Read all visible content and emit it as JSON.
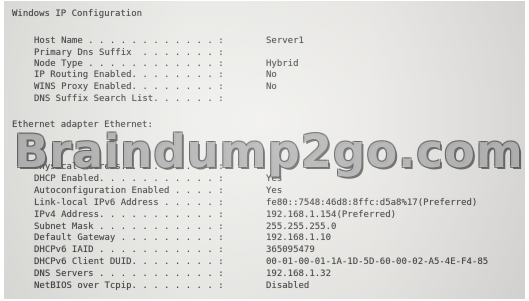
{
  "window_title": "Windows IP Configuration",
  "adapter_header": "Ethernet adapter Ethernet:",
  "watermark": "Braindump2go.com",
  "rows": [
    {
      "label": "Host Name . . . . . . . . . . . . :",
      "value": "Server1"
    },
    {
      "label": "Primary Dns Suffix  . . . . . . . :",
      "value": ""
    },
    {
      "label": "Node Type . . . . . . . . . . . . :",
      "value": "Hybrid"
    },
    {
      "label": "IP Routing Enabled. . . . . . . . :",
      "value": "No"
    },
    {
      "label": "WINS Proxy Enabled. . . . . . . . :",
      "value": "No"
    },
    {
      "label": "DNS Suffix Search List. . . . . . :",
      "value": ""
    },
    {
      "label": "Physical Address. . . . . . . . . :",
      "value": ""
    },
    {
      "label": "DHCP Enabled. . . . . . . . . . . :",
      "value": "Yes"
    },
    {
      "label": "Autoconfiguration Enabled . . . . :",
      "value": "Yes"
    },
    {
      "label": "Link-local IPv6 Address . . . . . :",
      "value": "fe80::7548:46d8:8ffc:d5a8%17(Preferred)"
    },
    {
      "label": "IPv4 Address. . . . . . . . . . . :",
      "value": "192.168.1.154(Preferred)"
    },
    {
      "label": "Subnet Mask . . . . . . . . . . . :",
      "value": "255.255.255.0"
    },
    {
      "label": "Default Gateway . . . . . . . . . :",
      "value": "192.168.1.10"
    },
    {
      "label": "DHCPv6 IAID . . . . . . . . . . . :",
      "value": "365095479"
    },
    {
      "label": "DHCPv6 Client DUID. . . . . . . . :",
      "value": "00-01-00-01-1A-1D-5D-60-00-02-A5-4E-F4-85"
    },
    {
      "label": "DNS Servers . . . . . . . . . . . :",
      "value": "192.168.1.32"
    },
    {
      "label": "NetBIOS over Tcpip. . . . . . . . :",
      "value": "Disabled"
    }
  ]
}
